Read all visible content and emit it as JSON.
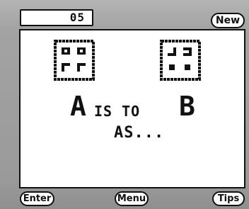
{
  "header": {
    "counter": "05",
    "new_label": "New"
  },
  "puzzle": {
    "letter_a": "A",
    "connector": "IS TO",
    "letter_b": "B",
    "ending": "AS..."
  },
  "footer": {
    "enter_label": "Enter",
    "menu_label": "Menu",
    "tips_label": "Tips"
  },
  "colors": {
    "ink": "#111111",
    "screen": "#ffffff",
    "bezel": "#a3a3a3"
  },
  "figures": {
    "box_a": {
      "cells": [
        "dot-square",
        "hollow-square",
        "corner-bracket",
        "corner-bracket-flipped"
      ]
    },
    "box_b": {
      "cells": [
        "hook-left",
        "hook-right",
        "dot-square",
        "dot-square"
      ]
    }
  }
}
